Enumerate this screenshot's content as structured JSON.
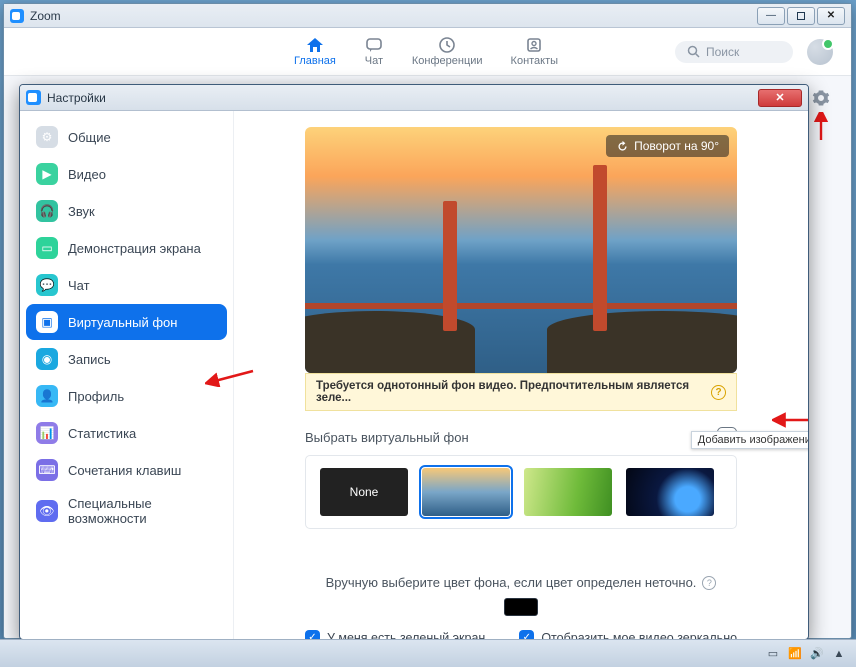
{
  "window": {
    "title": "Zoom"
  },
  "nav": {
    "tabs": [
      {
        "label": "Главная",
        "icon": "home"
      },
      {
        "label": "Чат",
        "icon": "chat"
      },
      {
        "label": "Конференции",
        "icon": "clock"
      },
      {
        "label": "Контакты",
        "icon": "contacts"
      }
    ],
    "search_placeholder": "Поиск"
  },
  "settings": {
    "title": "Настройки",
    "sidebar": [
      {
        "label": "Общие",
        "color": "#d6dde5"
      },
      {
        "label": "Видео",
        "color": "#3ad29f"
      },
      {
        "label": "Звук",
        "color": "#32c3a0"
      },
      {
        "label": "Демонстрация экрана",
        "color": "#2ed39a"
      },
      {
        "label": "Чат",
        "color": "#28c6cf"
      },
      {
        "label": "Виртуальный фон",
        "color": "#fff"
      },
      {
        "label": "Запись",
        "color": "#1aa8e0"
      },
      {
        "label": "Профиль",
        "color": "#37b8f5"
      },
      {
        "label": "Статистика",
        "color": "#8f7ce8"
      },
      {
        "label": "Сочетания клавиш",
        "color": "#7b6fe6"
      },
      {
        "label": "Специальные возможности",
        "color": "#5f6cf0"
      }
    ],
    "rotate_label": "Поворот на 90°",
    "warn_text": "Требуется однотонный фон видео. Предпочтительным является зеле...",
    "choose_label": "Выбрать виртуальный фон",
    "add_tooltip": "Добавить изображение",
    "thumbs": {
      "none": "None"
    },
    "manual_label": "Вручную выберите цвет фона, если цвет определен неточно.",
    "check_green": "У меня есть зеленый экран",
    "check_mirror": "Отобразить мое видео зеркально"
  }
}
